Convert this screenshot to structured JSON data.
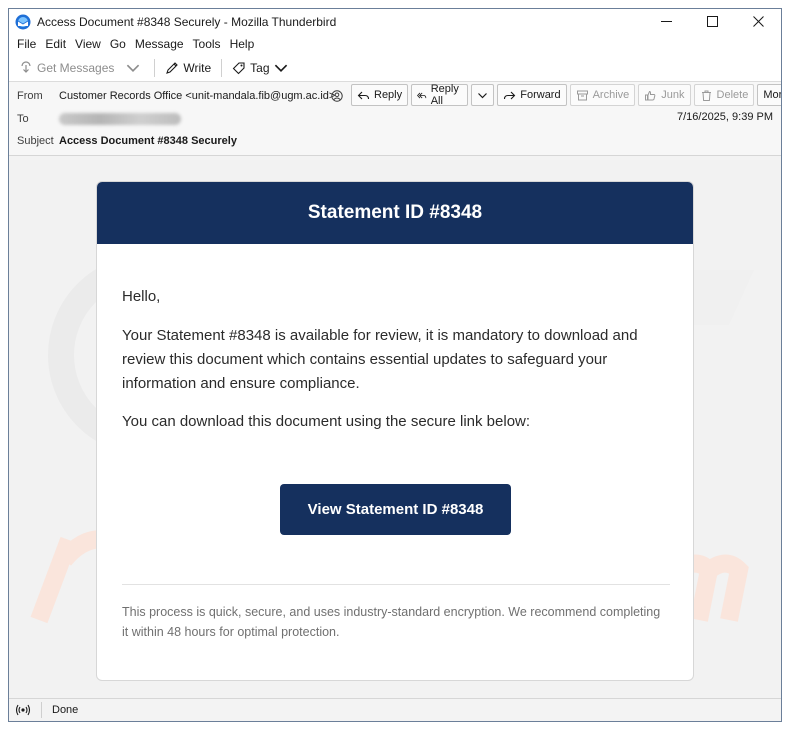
{
  "window": {
    "title": "Access Document #8348 Securely - Mozilla Thunderbird"
  },
  "menu": [
    "File",
    "Edit",
    "View",
    "Go",
    "Message",
    "Tools",
    "Help"
  ],
  "toolbar": {
    "get_messages": "Get Messages",
    "write": "Write",
    "tag": "Tag"
  },
  "header": {
    "from_label": "From",
    "from_value": "Customer Records Office <unit-mandala.fib@ugm.ac.id>",
    "to_label": "To",
    "subject_label": "Subject",
    "subject_value": "Access Document #8348 Securely",
    "date": "7/16/2025, 9:39 PM",
    "actions": {
      "reply": "Reply",
      "reply_all": "Reply All",
      "forward": "Forward",
      "archive": "Archive",
      "junk": "Junk",
      "delete": "Delete",
      "more": "More"
    }
  },
  "email": {
    "title": "Statement ID #8348",
    "greeting": "Hello,",
    "paragraph1": "Your Statement #8348 is available for review, it is mandatory to download and review this document which contains essential updates to safeguard your information and ensure compliance.",
    "paragraph2": "You can download this document using the secure link below:",
    "button": "View Statement ID #8348",
    "footer": "This process is quick, secure, and uses industry-standard encryption. We recommend completing it within 48 hours for optimal protection."
  },
  "status": {
    "text": "Done"
  },
  "colors": {
    "brand_navy": "#15305e",
    "window_border": "#6b7f99"
  }
}
